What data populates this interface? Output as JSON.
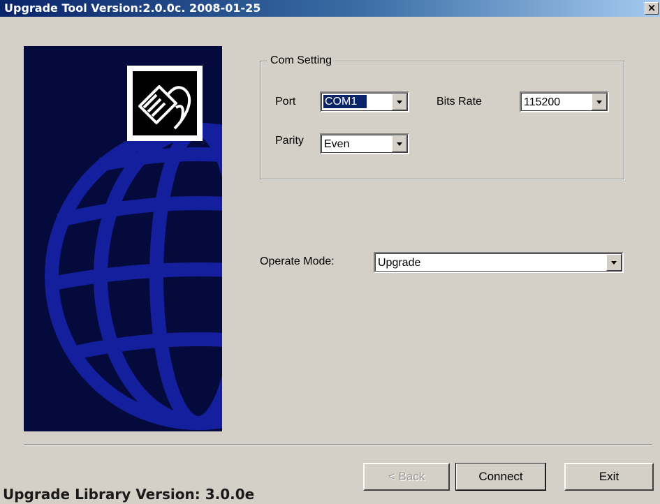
{
  "window": {
    "title": "Upgrade Tool Version:2.0.0c. 2008-01-25",
    "close_label": "×"
  },
  "side_panel": {
    "logo_icon": "network-cable-icon",
    "background_icon": "globe-icon"
  },
  "com_setting": {
    "legend": "Com Setting",
    "port_label": "Port",
    "port_value": "COM1",
    "bits_rate_label": "Bits Rate",
    "bits_rate_value": "115200",
    "parity_label": "Parity",
    "parity_value": "Even"
  },
  "operate": {
    "label": "Operate Mode:",
    "value": "Upgrade"
  },
  "buttons": {
    "back_label": "< Back",
    "connect_label": "Connect",
    "exit_label": "Exit"
  },
  "footer": {
    "library_version": "Upgrade Library Version: 3.0.0e"
  },
  "colors": {
    "title_bar": "#0a246a",
    "side_panel": "#050a3c",
    "globe": "#1622a8",
    "dialog": "#d4d0c8"
  }
}
